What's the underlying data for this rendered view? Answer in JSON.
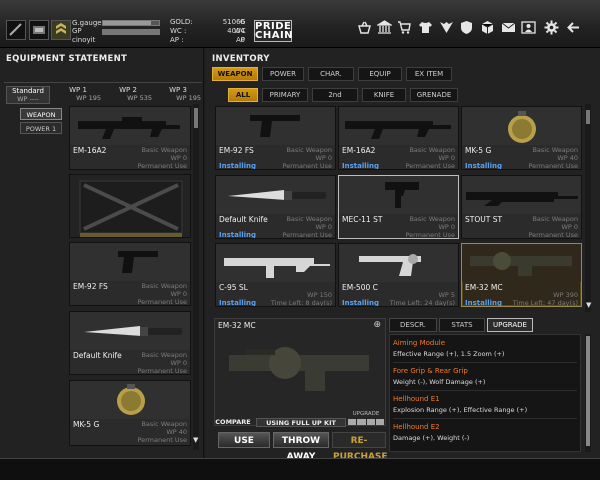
{
  "player": {
    "gauge_label": "G.gauge",
    "gp_label": "GP",
    "name": "cinoyit",
    "gauge_level": 0.85
  },
  "currency": {
    "gold_label": "GOLD:",
    "gold_value": "51066",
    "gold_unit": "G",
    "wc_label": "WC :",
    "wc_value": "4004",
    "wc_unit": "WC",
    "ap_label": "AP :",
    "ap_value": "0",
    "ap_unit": "AP"
  },
  "logo": {
    "line1": "PRIDE",
    "line2": "CHAIN"
  },
  "top_icons": [
    "basket-icon",
    "bank-icon",
    "cart-icon",
    "shirt-icon",
    "emblem-icon",
    "shield-icon",
    "crate-icon",
    "mail-icon",
    "user-icon",
    "gear-icon",
    "exit-icon"
  ],
  "equipment": {
    "title": "EQUIPMENT STATEMENT",
    "wp_tabs": [
      {
        "label": "Standard",
        "sub": "WP ----"
      },
      {
        "label": "WP 1",
        "sub": "WP 195"
      },
      {
        "label": "WP 2",
        "sub": "WP 535"
      },
      {
        "label": "WP 3",
        "sub": "WP 195"
      }
    ],
    "side_buttons": [
      "WEAPON",
      "POWER 1"
    ],
    "slots": [
      {
        "name": "EM-16A2",
        "type": "Basic Weapon",
        "wp": "WP 0",
        "usage": "Permanent Use"
      },
      {
        "name": "",
        "type": "",
        "wp": "",
        "usage": ""
      },
      {
        "name": "EM-92 FS",
        "type": "Basic Weapon",
        "wp": "WP 0",
        "usage": "Permanent Use"
      },
      {
        "name": "Default Knife",
        "type": "Basic Weapon",
        "wp": "WP 0",
        "usage": "Permanent Use"
      },
      {
        "name": "MK-5 G",
        "type": "Basic Weapon",
        "wp": "WP 40",
        "usage": "Permanent Use"
      }
    ]
  },
  "inventory": {
    "title": "INVENTORY",
    "main_tabs": [
      "WEAPON",
      "POWER",
      "CHAR.",
      "EQUIP",
      "EX ITEM"
    ],
    "sub_tabs": [
      "ALL",
      "PRIMARY",
      "2nd",
      "KNIFE",
      "GRENADE"
    ],
    "items": [
      {
        "name": "EM-92 FS",
        "type": "Basic Weapon",
        "wp": "WP 0",
        "status": "Installing",
        "usage": "Permanent Use"
      },
      {
        "name": "EM-16A2",
        "type": "Basic Weapon",
        "wp": "WP 0",
        "status": "Installing",
        "usage": "Permanent Use"
      },
      {
        "name": "MK-5 G",
        "type": "Basic Weapon",
        "wp": "WP 40",
        "status": "Installing",
        "usage": "Permanent Use"
      },
      {
        "name": "Default Knife",
        "type": "Basic Weapon",
        "wp": "WP 0",
        "status": "Installing",
        "usage": "Permanent Use"
      },
      {
        "name": "MEC-11 ST",
        "type": "Basic Weapon",
        "wp": "WP 0",
        "status": "",
        "usage": "Permanent Use"
      },
      {
        "name": "STOUT ST",
        "type": "Basic Weapon",
        "wp": "WP 0",
        "status": "",
        "usage": "Permanent Use"
      },
      {
        "name": "C-95 SL",
        "type": "",
        "wp": "WP 150",
        "status": "Installing",
        "usage": "Time Left: 8 day(s)"
      },
      {
        "name": "EM-500 C",
        "type": "",
        "wp": "WP 5",
        "status": "Installing",
        "usage": "Time Left: 24 day(s)"
      },
      {
        "name": "EM-32 MC",
        "type": "",
        "wp": "WP 390",
        "status": "Installing",
        "usage": "Time Left: 47 day(s)"
      }
    ]
  },
  "detail": {
    "item_name": "EM-32 MC",
    "compare_label": "COMPARE",
    "full_up_label": "USING FULL UP KIT",
    "upgrade_label": "UPGRADE",
    "tabs": [
      "DESCR.",
      "STATS",
      "UPGRADE"
    ],
    "upgrades": [
      {
        "title": "Aiming Module",
        "desc": "Effective Range (+), 1.5 Zoom (+)"
      },
      {
        "title": "Fore Grip & Rear Grip",
        "desc": "Weight (-), Wolf Damage (+)"
      },
      {
        "title": "Hellhound E1",
        "desc": "Explosion Range (+), Effective Range (+)"
      },
      {
        "title": "Hellhound E2",
        "desc": "Damage (+), Weight (-)"
      }
    ]
  },
  "actions": {
    "use": "USE",
    "throw": "THROW AWAY",
    "repurchase": "RE-PURCHASE"
  }
}
